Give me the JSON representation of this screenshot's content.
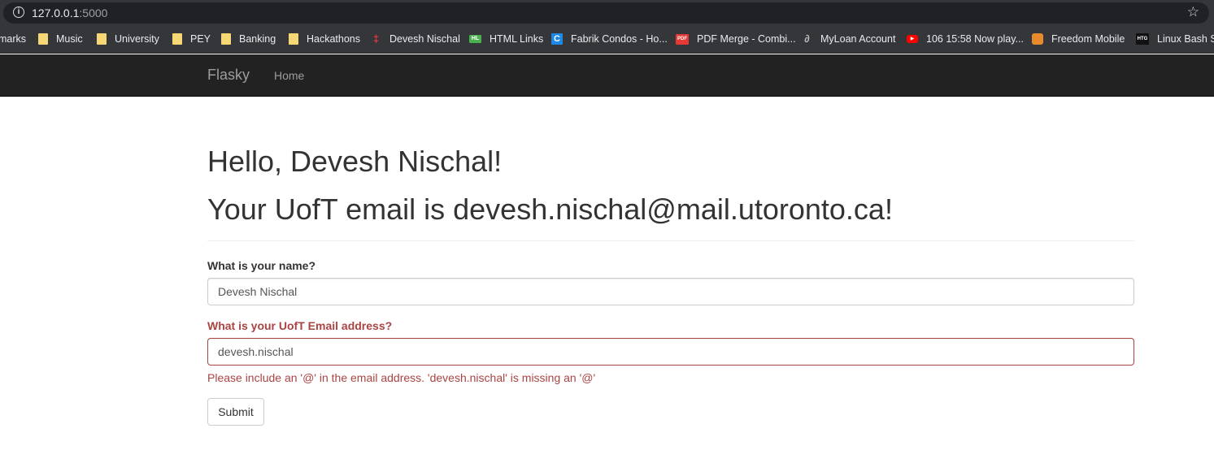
{
  "browser": {
    "url_host": "127.0.0.1",
    "url_port": ":5000",
    "bookmarks": [
      {
        "label": "marks",
        "icon": "none"
      },
      {
        "label": "Music",
        "icon": "folder-icon"
      },
      {
        "label": "University",
        "icon": "folder-icon"
      },
      {
        "label": "PEY",
        "icon": "folder-icon"
      },
      {
        "label": "Banking",
        "icon": "folder-icon"
      },
      {
        "label": "Hackathons",
        "icon": "folder-icon"
      },
      {
        "label": "Devesh Nischal",
        "icon": "site-icon"
      },
      {
        "label": "HTML Links",
        "icon": "site-icon"
      },
      {
        "label": "Fabrik Condos - Ho...",
        "icon": "site-icon"
      },
      {
        "label": "PDF Merge - Combi...",
        "icon": "pdf-icon"
      },
      {
        "label": "MyLoan Account",
        "icon": "site-icon"
      },
      {
        "label": "106 15:58 Now play...",
        "icon": "youtube-icon"
      },
      {
        "label": "Freedom Mobile",
        "icon": "site-icon"
      },
      {
        "label": "Linux Bash Sh",
        "icon": "site-icon"
      }
    ],
    "icon_glyphs": {
      "devesh": "‡",
      "html": "HL",
      "fabrik": "C",
      "pdf": "PDF",
      "loan": "∂",
      "yt": "▶",
      "htg": "HTG"
    }
  },
  "navbar": {
    "brand": "Flasky",
    "home_label": "Home"
  },
  "page": {
    "greeting": "Hello, Devesh Nischal!",
    "email_message": "Your UofT email is devesh.nischal@mail.utoronto.ca!"
  },
  "form": {
    "name_label": "What is your name?",
    "name_value": "Devesh Nischal",
    "email_label": "What is your UofT Email address?",
    "email_value": "devesh.nischal",
    "email_error": "Please include an '@' in the email address. 'devesh.nischal' is missing an '@'",
    "submit_label": "Submit"
  },
  "colors": {
    "navbar_bg": "#222222",
    "error": "#a94442",
    "text": "#333333"
  }
}
